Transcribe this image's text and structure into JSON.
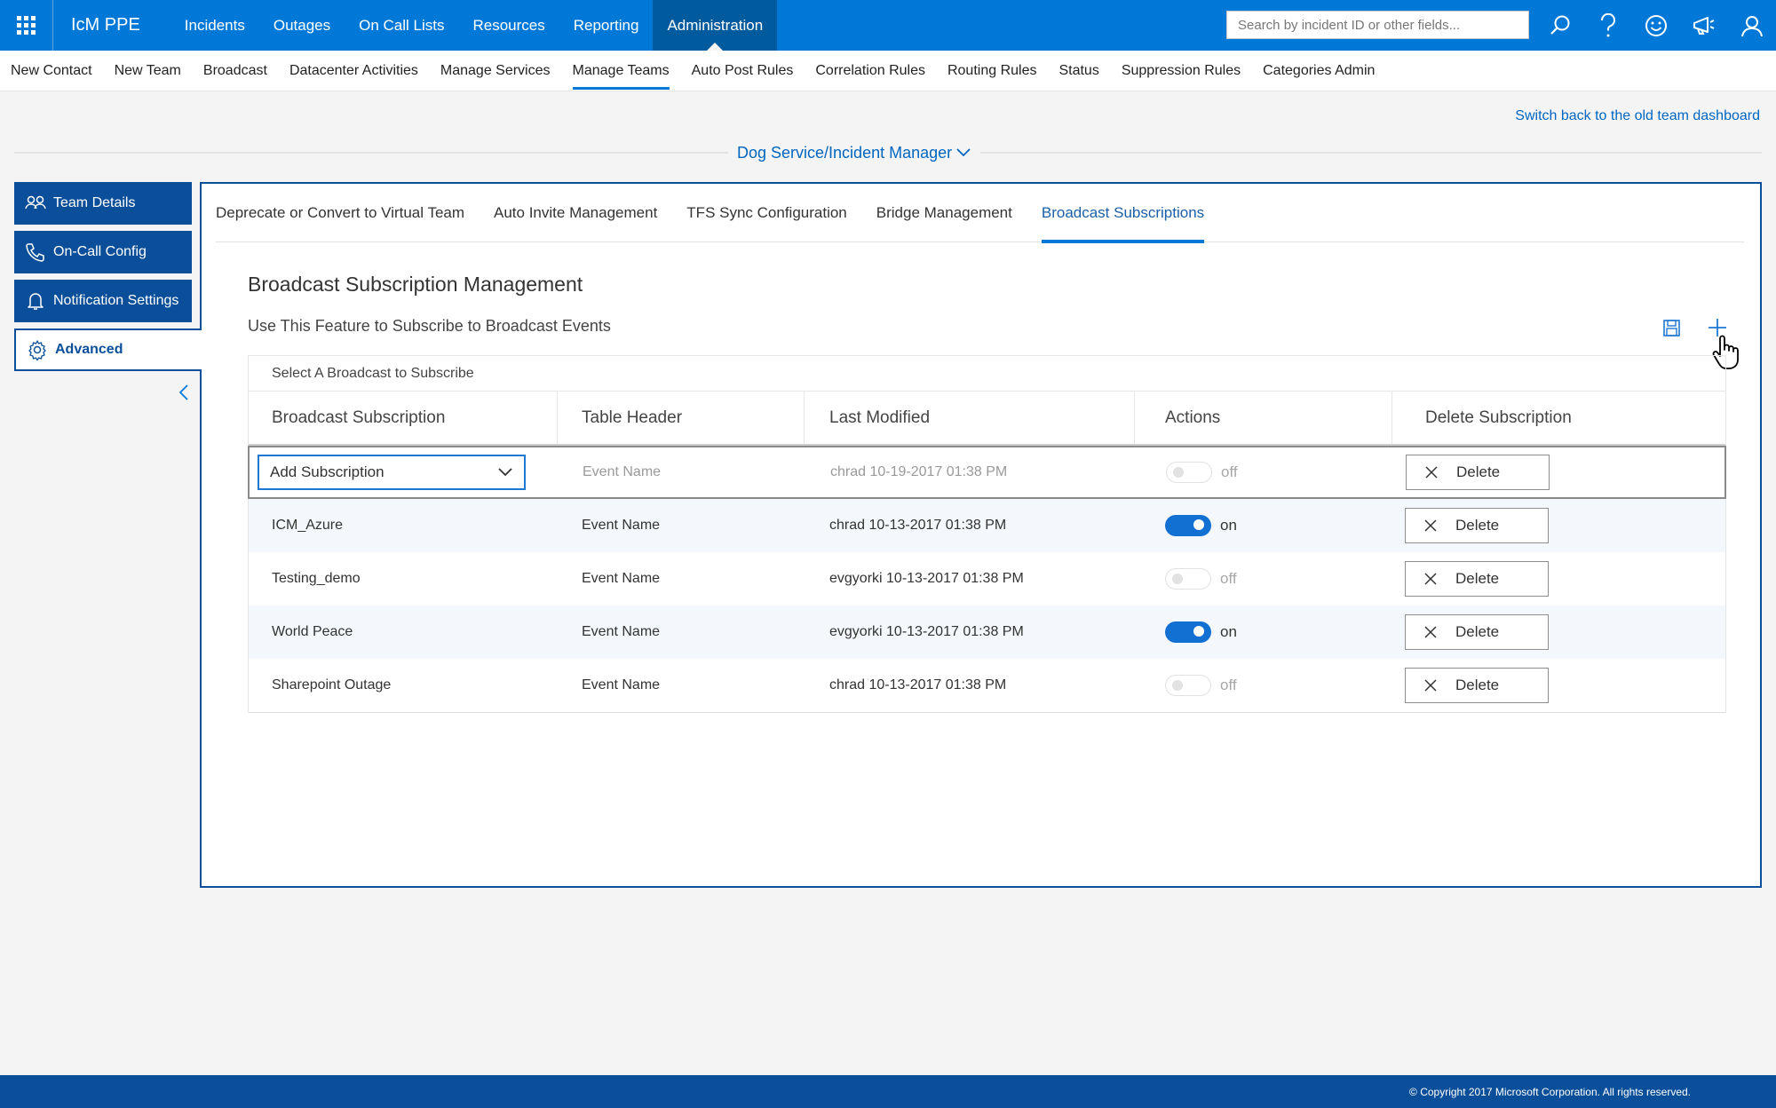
{
  "app": {
    "title": "IcM PPE"
  },
  "topnav": {
    "items": [
      "Incidents",
      "Outages",
      "On Call Lists",
      "Resources",
      "Reporting",
      "Administration"
    ],
    "active": "Administration"
  },
  "search": {
    "placeholder": "Search by incident ID or other fields..."
  },
  "topicons": [
    "search-icon",
    "help-icon",
    "smiley-icon",
    "megaphone-icon",
    "user-icon"
  ],
  "subnav": {
    "items": [
      "New Contact",
      "New Team",
      "Broadcast",
      "Datacenter Activities",
      "Manage Services",
      "Manage Teams",
      "Auto Post Rules",
      "Correlation Rules",
      "Routing Rules",
      "Status",
      "Suppression Rules",
      "Categories Admin"
    ],
    "active": "Manage Teams"
  },
  "switch_link": "Switch back to the old team dashboard",
  "team_selector": "Dog Service/Incident Manager",
  "sidemenu": {
    "items": [
      "Team Details",
      "On-Call Config",
      "Notification Settings",
      "Advanced"
    ],
    "active": "Advanced"
  },
  "tabs": {
    "items": [
      "Deprecate or Convert to Virtual Team",
      "Auto Invite Management",
      "TFS Sync Configuration",
      "Bridge Management",
      "Broadcast Subscriptions"
    ],
    "active": "Broadcast Subscriptions"
  },
  "section": {
    "title": "Broadcast Subscription Management",
    "subtitle": "Use This Feature to Subscribe to Broadcast Events"
  },
  "table": {
    "caption": "Select A Broadcast to Subscribe",
    "headers": [
      "Broadcast Subscription",
      "Table Header",
      "Last Modified",
      "Actions",
      "Delete Subscription"
    ],
    "new_row": {
      "dropdown": "Add Subscription",
      "event": "Event Name",
      "modified": "chrad 10-19-2017 01:38 PM",
      "toggle": "off",
      "delete": "Delete"
    },
    "rows": [
      {
        "name": "ICM_Azure",
        "event": "Event Name",
        "modified": "chrad 10-13-2017 01:38 PM",
        "toggle": "on",
        "delete": "Delete"
      },
      {
        "name": "Testing_demo",
        "event": "Event Name",
        "modified": "evgyorki 10-13-2017 01:38 PM",
        "toggle": "off",
        "delete": "Delete"
      },
      {
        "name": "World Peace",
        "event": "Event Name",
        "modified": "evgyorki 10-13-2017 01:38 PM",
        "toggle": "on",
        "delete": "Delete"
      },
      {
        "name": "Sharepoint Outage",
        "event": "Event Name",
        "modified": "chrad 10-13-2017 01:38 PM",
        "toggle": "off",
        "delete": "Delete"
      }
    ]
  },
  "footer": "© Copyright 2017 Microsoft Corporation. All rights reserved.",
  "colors": {
    "primary": "#0078d7",
    "dark_blue": "#0b4f9a",
    "toggle_on": "#1370d3"
  }
}
